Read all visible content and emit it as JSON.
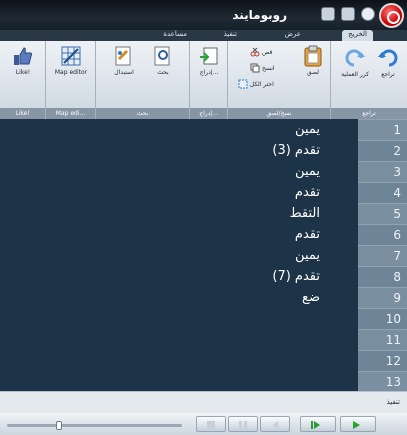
{
  "window": {
    "title": "روبومايند"
  },
  "tabs": [
    {
      "label": "الخريج",
      "active": true
    },
    {
      "label": "عرض",
      "active": false
    },
    {
      "label": "تنفيذ",
      "active": false
    },
    {
      "label": "مساعدة",
      "active": false
    }
  ],
  "ribbon": {
    "groups": {
      "undo": "تراجع",
      "clipboard": "نسخ/لصق",
      "insert": "إدراج...",
      "search": "بحث",
      "map_editor": "Map edi...",
      "like": "Like!"
    },
    "buttons": {
      "undo": "تراجع",
      "redo": "كرر العملية",
      "paste": "لصق",
      "cut": "قص",
      "copy": "انسخ",
      "select_all": "اختر الكل",
      "insert": "إدراج...",
      "search": "بحث",
      "replace": "استبدال",
      "map_editor": "Map editor",
      "like": "Like!"
    }
  },
  "editor": {
    "lines": [
      "يمين",
      "تقدم (3)",
      "يمين",
      "تقدم",
      "التقط",
      "تقدم",
      "يمين",
      "تقدم (7)",
      "ضع",
      "",
      "",
      "",
      ""
    ],
    "line_numbers": [
      "1",
      "2",
      "3",
      "4",
      "5",
      "6",
      "7",
      "8",
      "9",
      "10",
      "11",
      "12",
      "13"
    ]
  },
  "status": {
    "label": "تنفيذ"
  },
  "colors": {
    "editor_bg": "#1d3448",
    "gutter": "#6e8597",
    "play_green": "#22a52e"
  },
  "icons": [
    "app-orb-icon",
    "save-icon",
    "new-icon",
    "menu-icon",
    "undo-icon",
    "redo-icon",
    "paste-icon",
    "cut-icon",
    "copy-icon",
    "select-all-icon",
    "insert-icon",
    "search-icon",
    "replace-icon",
    "map-editor-icon",
    "like-icon",
    "play-icon",
    "step-icon",
    "pause-icon",
    "stop-icon"
  ]
}
